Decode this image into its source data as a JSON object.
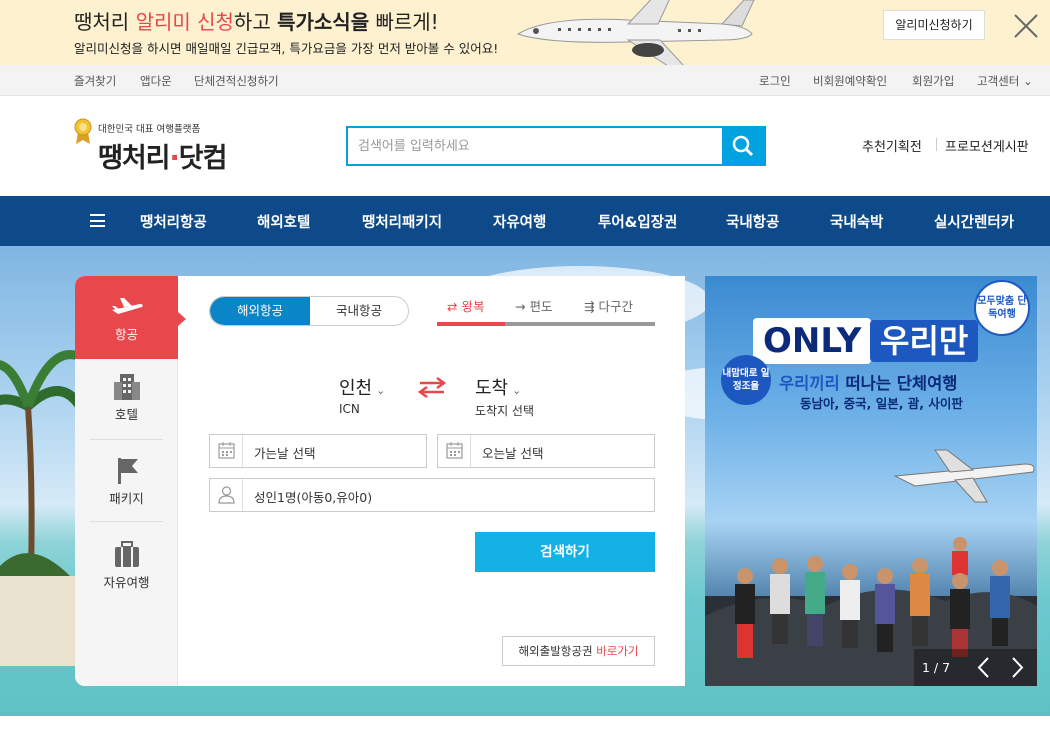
{
  "banner": {
    "title_part1": "땡처리 ",
    "title_highlight": "알리미 신청",
    "title_part2": "하고 ",
    "title_bold": "특가소식을",
    "title_part3": " 빠르게!",
    "subtitle": "알리미신청을 하시면 매일매일 긴급모객, 특가요금을 가장 먼저 받아볼 수 있어요!",
    "notify_button": "알리미신청하기",
    "close_icon": "close-icon"
  },
  "util_left": [
    "즐겨찾기",
    "앱다운",
    "단체견적신청하기"
  ],
  "util_right": [
    "로그인",
    "비회원예약확인",
    "회원가입",
    "고객센터"
  ],
  "logo": {
    "tagline": "대한민국 대표 여행플랫폼",
    "name_part1": "땡처리",
    "name_part2": "닷컴"
  },
  "search": {
    "placeholder": "검색어를 입력하세요",
    "value": "",
    "icon": "search-icon"
  },
  "header_links": [
    "추천기획전",
    "프로모션게시판"
  ],
  "gnb": {
    "menu_icon": "hamburger-icon",
    "items": [
      "땡처리항공",
      "해외호텔",
      "땡처리패키지",
      "자유여행",
      "투어&입장권",
      "국내항공",
      "국내숙박",
      "실시간렌터카"
    ]
  },
  "booking": {
    "side": [
      {
        "label": "항공",
        "icon": "airplane-icon",
        "active": true
      },
      {
        "label": "호텔",
        "icon": "building-icon",
        "active": false
      },
      {
        "label": "패키지",
        "icon": "flag-icon",
        "active": false
      },
      {
        "label": "자유여행",
        "icon": "suitcase-icon",
        "active": false
      }
    ],
    "segment": {
      "active": "해외항공",
      "inactive": "국내항공"
    },
    "trip_tabs": [
      {
        "label": "왕복",
        "active": true
      },
      {
        "label": "편도",
        "active": false
      },
      {
        "label": "다구간",
        "active": false
      }
    ],
    "from": {
      "city": "인천",
      "sub": "ICN"
    },
    "to": {
      "city": "도착",
      "sub": "도착지 선택"
    },
    "depart_date": "가는날 선택",
    "return_date": "오는날 선택",
    "passengers": "성인1명(아동0,유아0)",
    "search_button": "검색하기",
    "link_text": "해외출발항공권 ",
    "link_go": "바로가기"
  },
  "promo": {
    "badge_top": "모두맞춤 단독여행",
    "only": "ONLY",
    "uri": "우리만",
    "badge_left": "내맘대로 일정조율",
    "headline_part1": "우리끼리 ",
    "headline_part2": "떠나는 단체여행",
    "destinations": "동남아, 중국, 일본, 괌, 사이판",
    "pager": "1 / 7"
  },
  "colors": {
    "accent_red": "#e8474b",
    "nav_blue": "#0e4a8a",
    "search_blue": "#00a3e0",
    "button_blue": "#14b1e7"
  }
}
